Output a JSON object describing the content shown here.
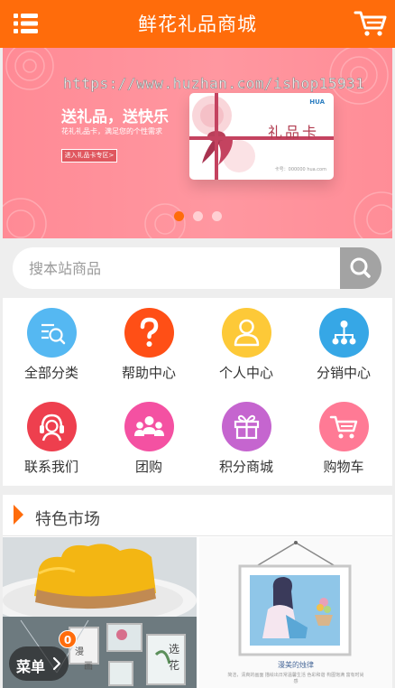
{
  "header": {
    "title": "鲜花礼品商城",
    "menu_icon": "list-menu-icon",
    "cart_icon": "shopping-cart-icon",
    "accent_color": "#ff6c0b"
  },
  "banner": {
    "watermark": "https://www.huzhan.com/ishop15931",
    "slogan": "送礼品，送快乐",
    "subtitle": "花礼礼品卡，满足您的个性需求",
    "promo_button": "进入礼品卡专区>",
    "card_title": "礼品卡",
    "card_brand": "HUA",
    "card_footer": "卡号：000000   hua.com",
    "slides": 3,
    "active_slide": 1
  },
  "search": {
    "placeholder": "搜本站商品",
    "button_icon": "search-icon"
  },
  "nav_grid": [
    {
      "label": "全部分类",
      "icon": "category-search-icon",
      "color": "#55b8f2"
    },
    {
      "label": "帮助中心",
      "icon": "question-mark-icon",
      "color": "#ff4f16"
    },
    {
      "label": "个人中心",
      "icon": "user-icon",
      "color": "#fdc938"
    },
    {
      "label": "分销中心",
      "icon": "distribution-tree-icon",
      "color": "#36a7e6"
    },
    {
      "label": "联系我们",
      "icon": "customer-service-icon",
      "color": "#ee3f4e"
    },
    {
      "label": "团购",
      "icon": "group-people-icon",
      "color": "#f451a2"
    },
    {
      "label": "积分商城",
      "icon": "gift-icon",
      "color": "#c565cf"
    },
    {
      "label": "购物车",
      "icon": "shopping-cart-icon",
      "color": "#ff7a95"
    }
  ],
  "market": {
    "title": "特色市场",
    "right_caption": "漫美的烛律",
    "right_subcaption": "简洁，清爽的画面 描绘出日常温馨生活 色彩和谐 构图饱满 富有时尚感"
  },
  "floating_menu": {
    "label": "菜单",
    "badge": "0",
    "chevron_icon": "chevron-right-icon"
  },
  "left_product": {
    "frame_text_1": "漫",
    "frame_text_2": "画",
    "frame_text_3": "选",
    "frame_text_4": "花"
  }
}
